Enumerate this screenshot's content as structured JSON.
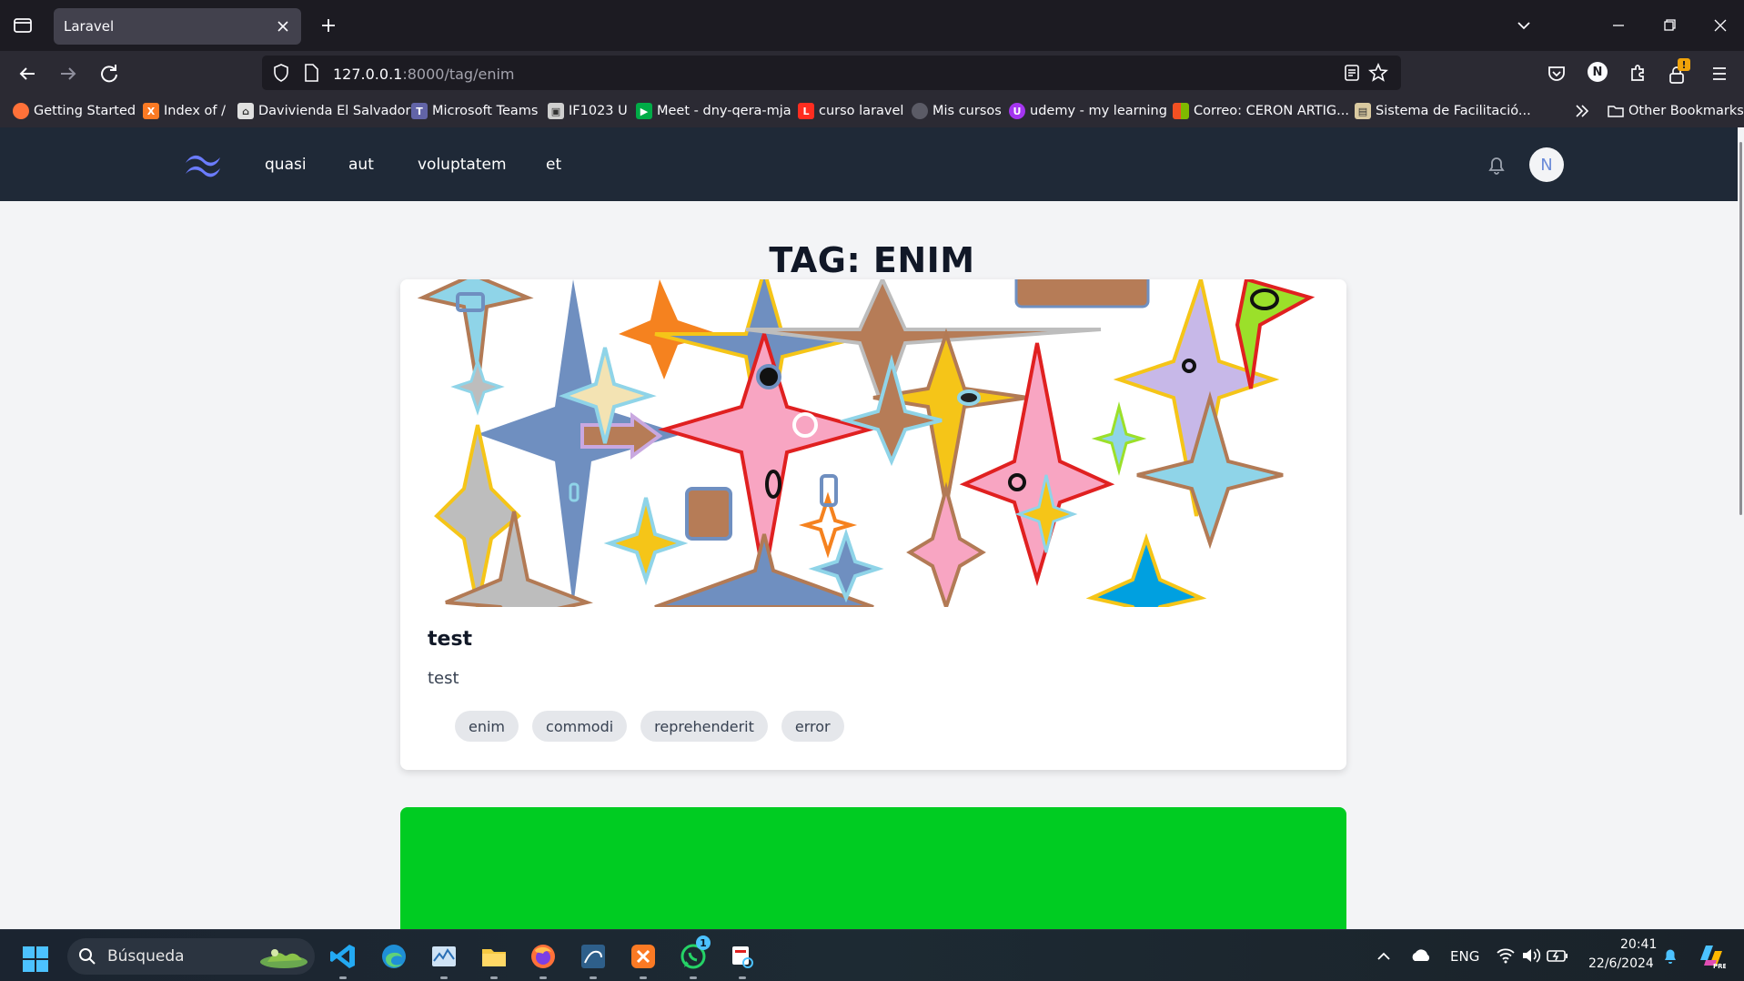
{
  "browser": {
    "tab_title": "Laravel",
    "url_host": "127.0.0.1",
    "url_rest": ":8000/tag/enim",
    "bookmarks": [
      {
        "label": "Getting Started",
        "icon": "firefox-icon",
        "color": "#ff7139"
      },
      {
        "label": "Index of /",
        "icon": "xampp-icon",
        "color": "#fb7a24"
      },
      {
        "label": "Davivienda El Salvador",
        "icon": "bank-icon",
        "color": "#e0e0e0"
      },
      {
        "label": "Microsoft Teams",
        "icon": "teams-icon",
        "color": "#6264a7"
      },
      {
        "label": "IF1023 U",
        "icon": "id-card-icon",
        "color": "#cfcfcf"
      },
      {
        "label": "Meet - dny-qera-mja",
        "icon": "meet-icon",
        "color": "#00ac47"
      },
      {
        "label": "curso laravel",
        "icon": "laravel-icon",
        "color": "#ff2d20"
      },
      {
        "label": "Mis cursos",
        "icon": "globe-icon",
        "color": "#5b5b66"
      },
      {
        "label": "udemy - my learning",
        "icon": "udemy-icon",
        "color": "#a435f0"
      },
      {
        "label": "Correo: CERON ARTIG...",
        "icon": "microsoft-icon",
        "color": "#f25022"
      },
      {
        "label": "Sistema de Facilitació...",
        "icon": "document-icon",
        "color": "#d9c9a0"
      }
    ],
    "other_bookmarks": "Other Bookmarks",
    "profile_initial": "N",
    "extension_badge": "!"
  },
  "app": {
    "nav_links": [
      "quasi",
      "aut",
      "voluptatem",
      "et"
    ],
    "avatar_initial": "N",
    "page_title": "TAG: ENIM",
    "post": {
      "title": "test",
      "body": "test",
      "tags": [
        "enim",
        "commodi",
        "reprehenderit",
        "error"
      ]
    },
    "second_card_color": "#00cc22"
  },
  "taskbar": {
    "search_placeholder": "Búsqueda",
    "language": "ENG",
    "time": "20:41",
    "date": "22/6/2024",
    "whatsapp_badge": "1"
  }
}
